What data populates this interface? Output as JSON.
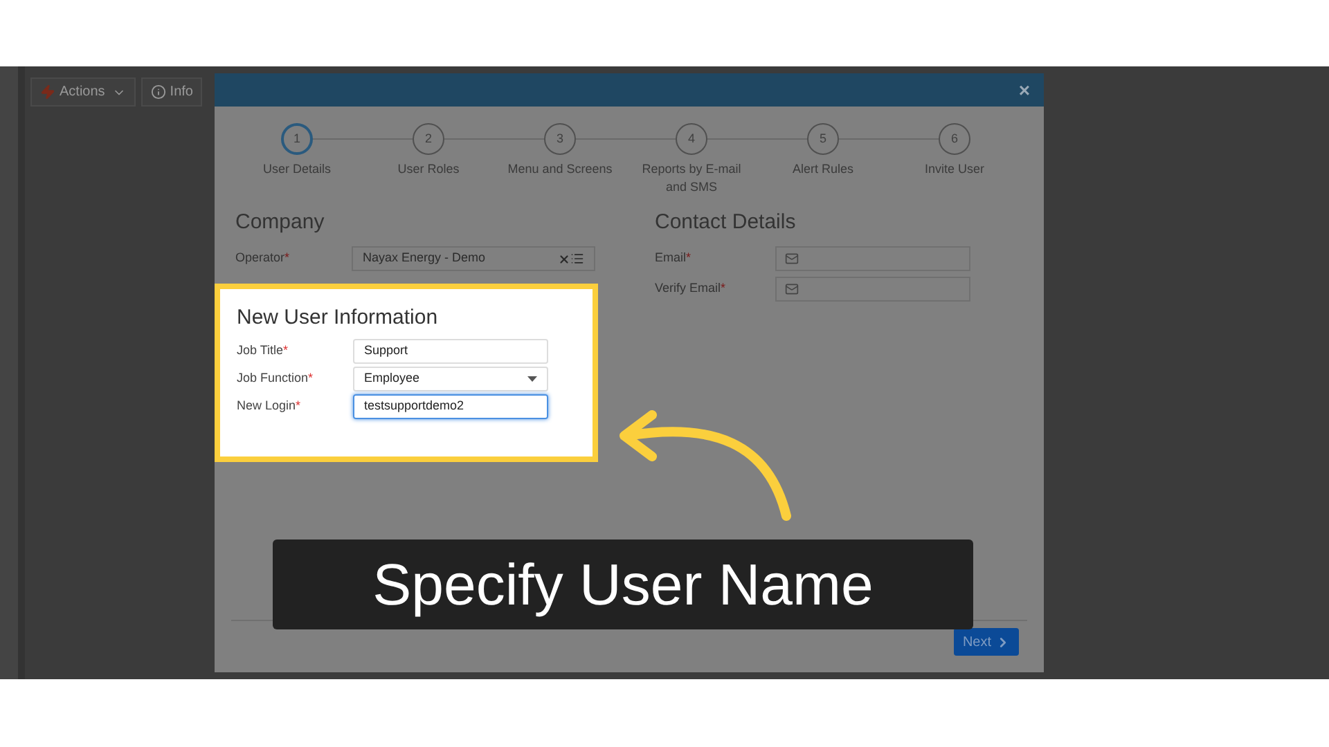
{
  "toolbar": [
    {
      "label": "Actions",
      "kind": "menu"
    },
    {
      "label": "Info",
      "kind": "info"
    }
  ],
  "dialog": {
    "close": "×",
    "steps": [
      {
        "number": "1",
        "label": "User Details",
        "selected": true
      },
      {
        "number": "2",
        "label": "User Roles",
        "selected": false
      },
      {
        "number": "3",
        "label": "Menu and Screens",
        "selected": false
      },
      {
        "number": "4",
        "label": "Reports by E-mail and SMS",
        "selected": false
      },
      {
        "number": "5",
        "label": "Alert Rules",
        "selected": false
      },
      {
        "number": "6",
        "label": "Invite User",
        "selected": false
      }
    ],
    "company": {
      "heading": "Company",
      "fields": [
        {
          "label": "Operator",
          "value": "Nayax Energy - Demo"
        }
      ]
    },
    "contact": {
      "heading": "Contact Details",
      "fields": [
        {
          "label": "Email"
        },
        {
          "label": "Verify Email"
        }
      ]
    },
    "new_user": {
      "heading": "New User Information",
      "fields": [
        {
          "label": "Job Title",
          "value": "Support",
          "kind": "text",
          "focused": false
        },
        {
          "label": "Job Function",
          "value": "Employee",
          "kind": "select",
          "focused": false
        },
        {
          "label": "New Login",
          "value": "testsupportdemo2",
          "kind": "text",
          "focused": true
        }
      ]
    },
    "required_mark": "*",
    "next_button": "Next"
  },
  "caption": "Specify User Name"
}
